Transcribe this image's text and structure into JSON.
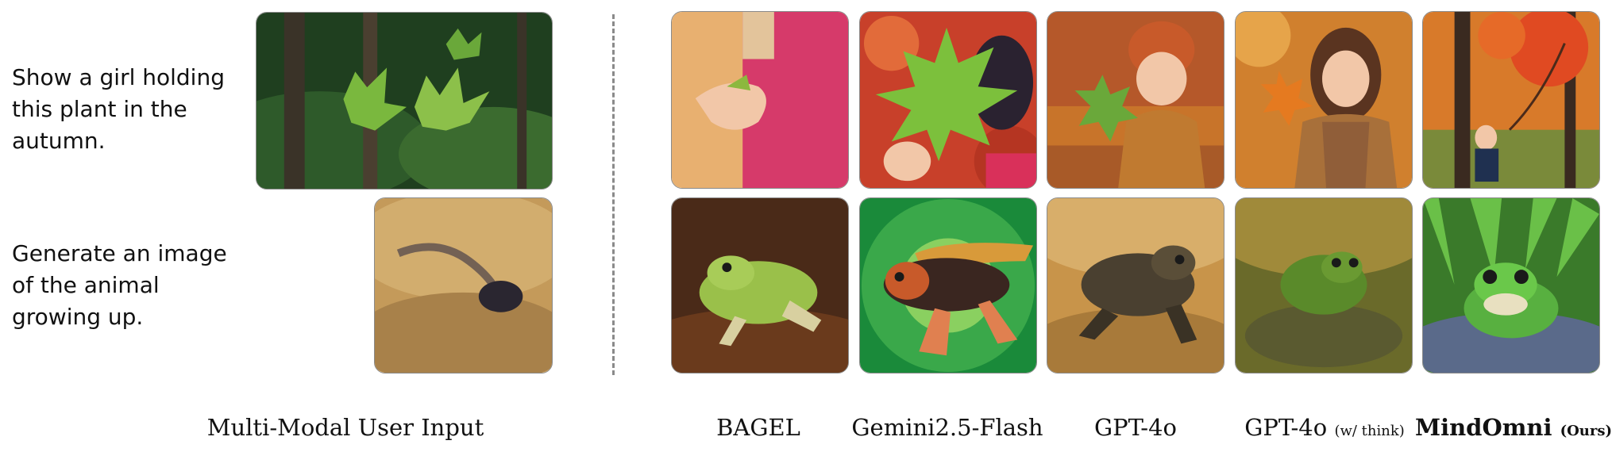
{
  "prompts": [
    {
      "lines": [
        "Show a girl holding",
        "this plant in the",
        "autumn."
      ]
    },
    {
      "lines": [
        "Generate an image",
        "of the animal",
        "growing up."
      ]
    }
  ],
  "input_caption": "Multi-Modal User Input",
  "models": [
    {
      "name": "BAGEL",
      "suffix": ""
    },
    {
      "name": "Gemini2.5-Flash",
      "suffix": ""
    },
    {
      "name": "GPT-4o",
      "suffix": ""
    },
    {
      "name": "GPT-4o",
      "suffix": "(w/ think)"
    },
    {
      "name": "MindOmni",
      "suffix": "(Ours)"
    }
  ]
}
